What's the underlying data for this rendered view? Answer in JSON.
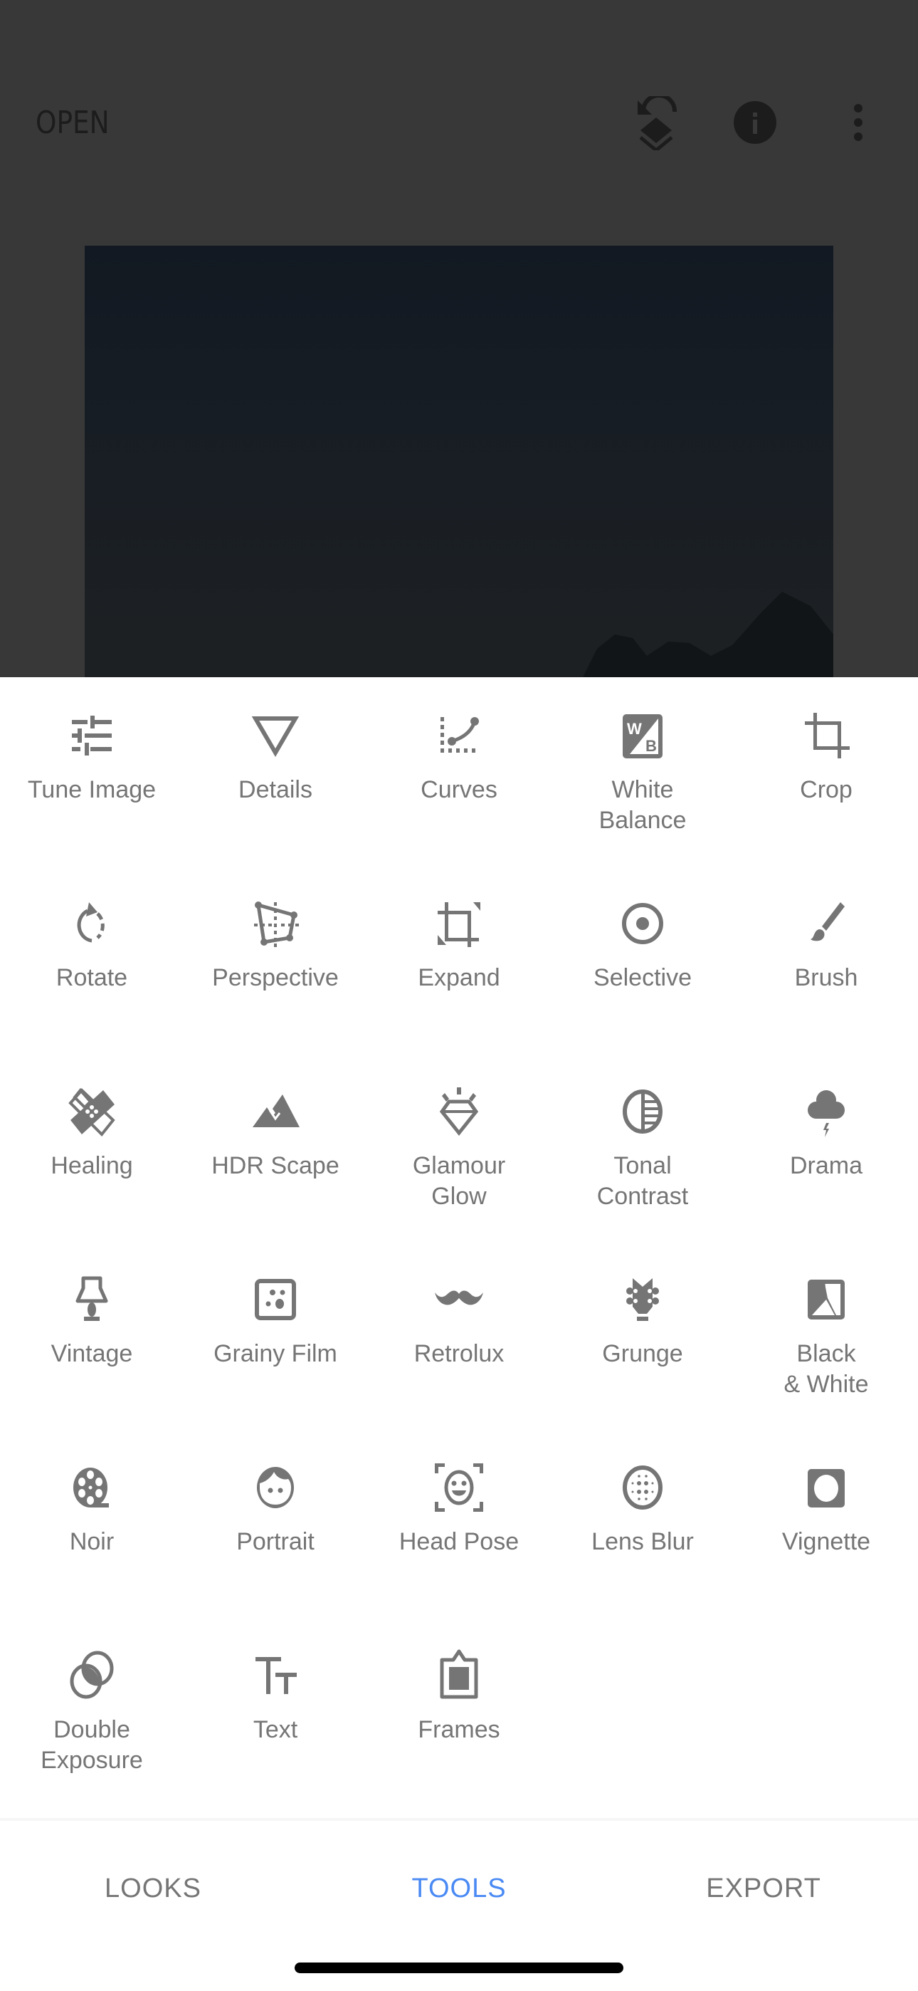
{
  "header": {
    "open_label": "OPEN",
    "icons": [
      "undo-layers-icon",
      "info-icon",
      "more-vert-icon"
    ]
  },
  "photo": {
    "description": "dark night sky photo with tree silhouettes"
  },
  "tools": [
    {
      "label": "Tune Image",
      "icon": "sliders-icon"
    },
    {
      "label": "Details",
      "icon": "triangle-down-icon"
    },
    {
      "label": "Curves",
      "icon": "curves-icon"
    },
    {
      "label": "White\nBalance",
      "icon": "white-balance-icon"
    },
    {
      "label": "Crop",
      "icon": "crop-icon"
    },
    {
      "label": "Rotate",
      "icon": "rotate-icon"
    },
    {
      "label": "Perspective",
      "icon": "perspective-icon"
    },
    {
      "label": "Expand",
      "icon": "expand-icon"
    },
    {
      "label": "Selective",
      "icon": "selective-icon"
    },
    {
      "label": "Brush",
      "icon": "brush-icon"
    },
    {
      "label": "Healing",
      "icon": "bandage-icon"
    },
    {
      "label": "HDR Scape",
      "icon": "mountain-icon"
    },
    {
      "label": "Glamour\nGlow",
      "icon": "diamond-icon"
    },
    {
      "label": "Tonal\nContrast",
      "icon": "tonal-contrast-icon"
    },
    {
      "label": "Drama",
      "icon": "storm-cloud-icon"
    },
    {
      "label": "Vintage",
      "icon": "lamp-icon"
    },
    {
      "label": "Grainy Film",
      "icon": "grain-icon"
    },
    {
      "label": "Retrolux",
      "icon": "mustache-icon"
    },
    {
      "label": "Grunge",
      "icon": "guitar-head-icon"
    },
    {
      "label": "Black\n& White",
      "icon": "black-white-icon"
    },
    {
      "label": "Noir",
      "icon": "film-reel-icon"
    },
    {
      "label": "Portrait",
      "icon": "face-icon"
    },
    {
      "label": "Head Pose",
      "icon": "face-frame-icon"
    },
    {
      "label": "Lens Blur",
      "icon": "lens-blur-icon"
    },
    {
      "label": "Vignette",
      "icon": "vignette-icon"
    },
    {
      "label": "Double\nExposure",
      "icon": "double-exposure-icon"
    },
    {
      "label": "Text",
      "icon": "text-icon"
    },
    {
      "label": "Frames",
      "icon": "frame-icon"
    }
  ],
  "bottom_nav": {
    "tabs": [
      {
        "label": "LOOKS",
        "active": false
      },
      {
        "label": "TOOLS",
        "active": true
      },
      {
        "label": "EXPORT",
        "active": false
      }
    ]
  },
  "colors": {
    "accent": "#4a8af4",
    "icon_gray": "#757575",
    "overlay_bg": "#383838"
  }
}
